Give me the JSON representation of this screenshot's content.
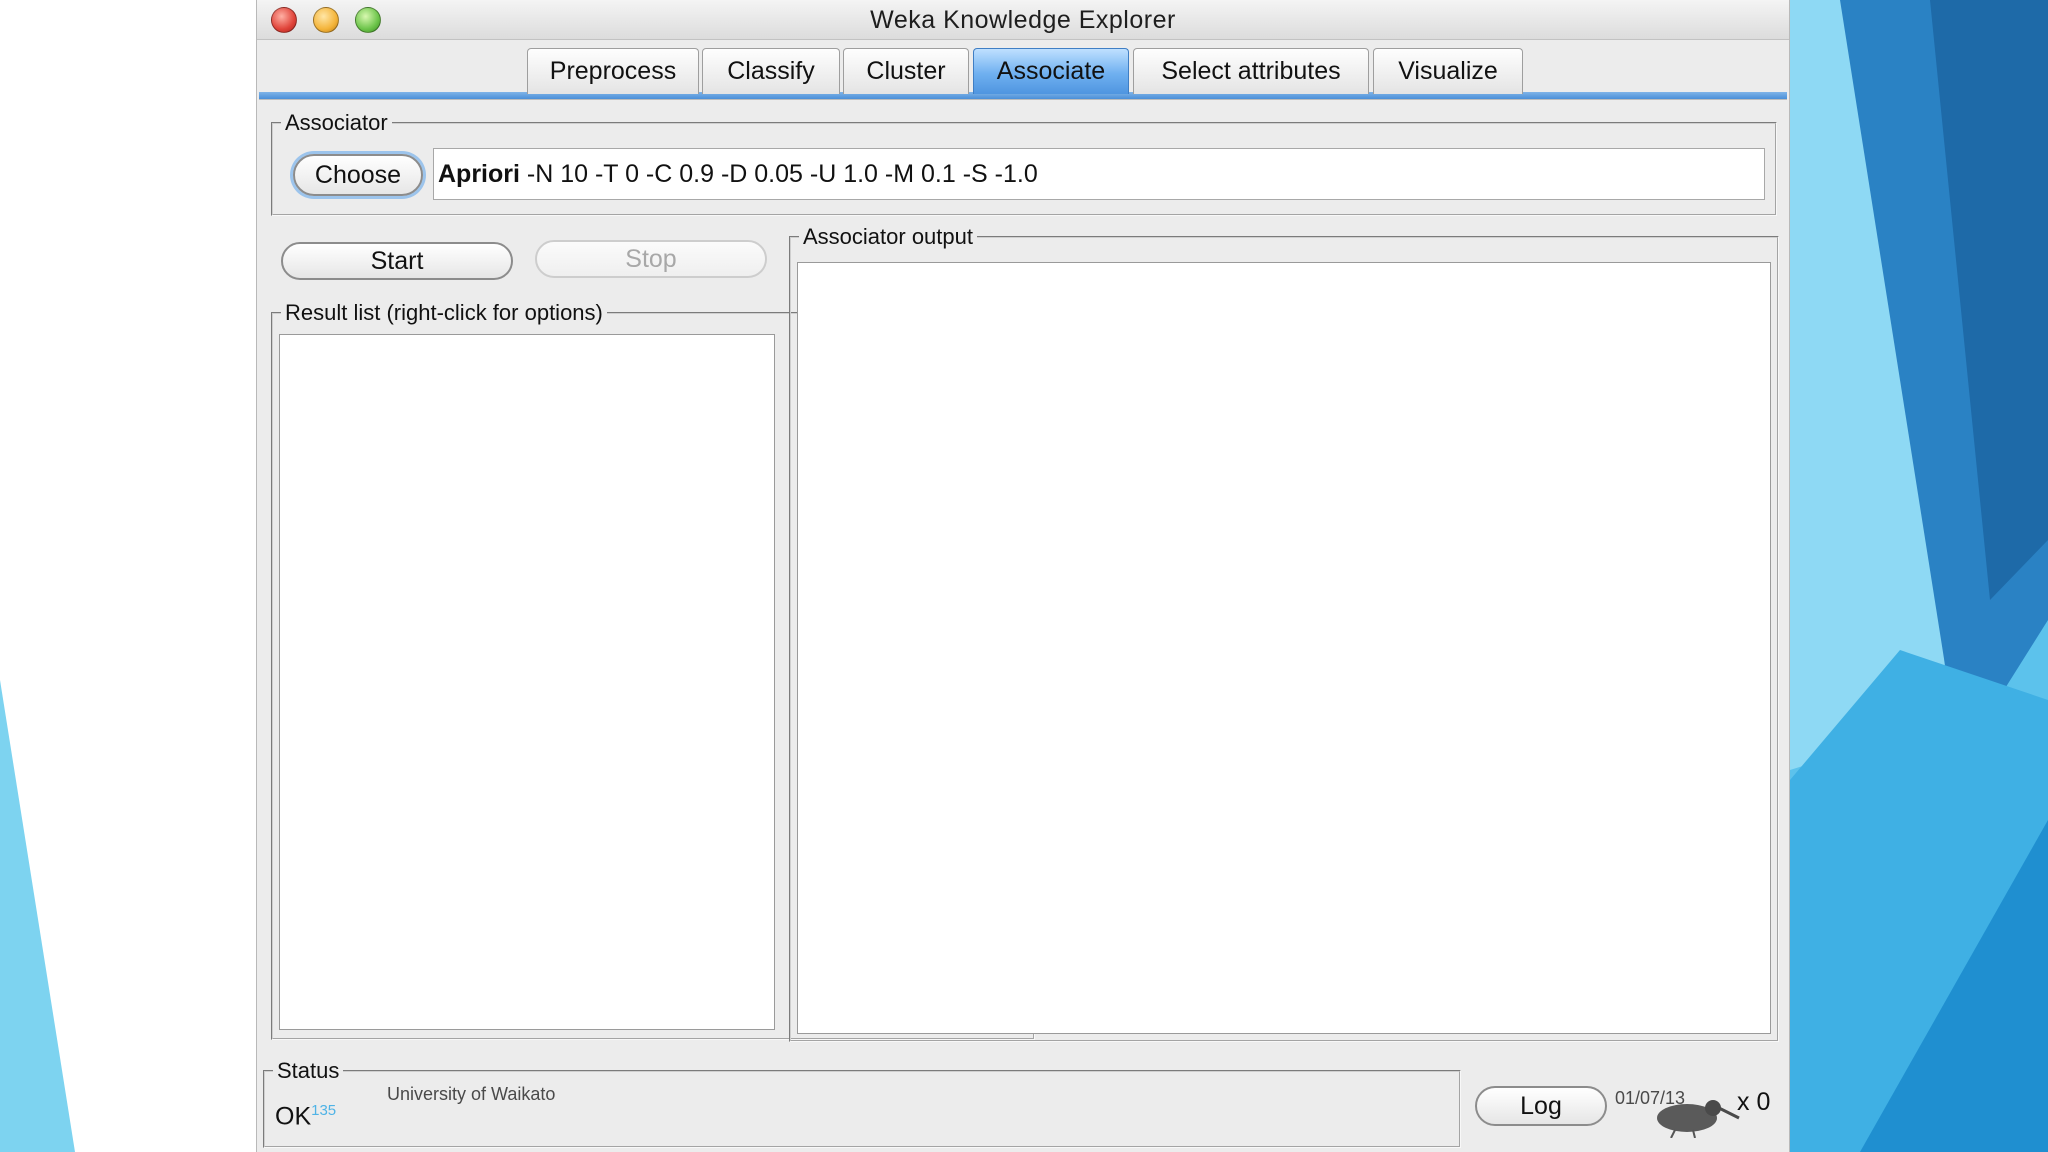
{
  "window": {
    "title": "Weka Knowledge Explorer"
  },
  "tabs": [
    {
      "label": "Preprocess",
      "active": false
    },
    {
      "label": "Classify",
      "active": false
    },
    {
      "label": "Cluster",
      "active": false
    },
    {
      "label": "Associate",
      "active": true
    },
    {
      "label": "Select attributes",
      "active": false
    },
    {
      "label": "Visualize",
      "active": false
    }
  ],
  "associator": {
    "group_title": "Associator",
    "choose_label": "Choose",
    "algorithm_name": "Apriori",
    "algorithm_options": "-N 10 -T 0 -C 0.9 -D 0.05 -U 1.0 -M 0.1 -S -1.0"
  },
  "controls": {
    "start_label": "Start",
    "stop_label": "Stop"
  },
  "result_list": {
    "title": "Result list (right-click for options)"
  },
  "output": {
    "title": "Associator output"
  },
  "status": {
    "group_title": "Status",
    "text": "OK",
    "slide_number": "135",
    "footer_text": "University of Waikato",
    "date_text": "01/07/13",
    "log_label": "Log",
    "task_count": "x 0"
  },
  "colors": {
    "accent_blue": "#4f95e0",
    "slide_blue_light": "#7dd3f0",
    "slide_blue_dark": "#1e6aa8"
  },
  "icons": {
    "weka_bird": "weka-bird-icon"
  }
}
